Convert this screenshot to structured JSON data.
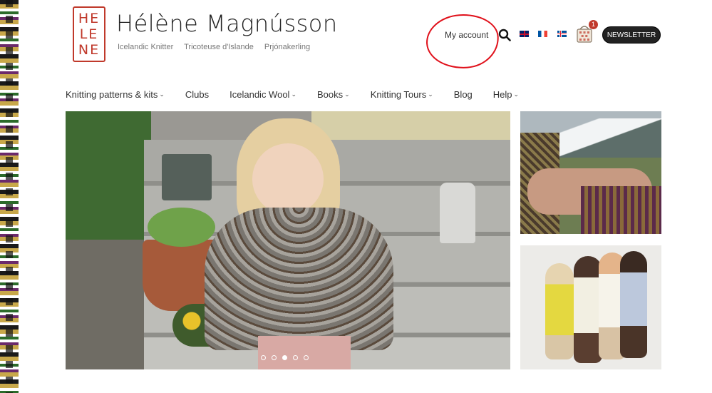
{
  "brand": {
    "logo_letters": [
      "HE",
      "LE",
      "NE"
    ],
    "name": "Hélène Magnússon",
    "taglines": [
      "Icelandic Knitter",
      "Tricoteuse d'Islande",
      "Prjónakerling"
    ]
  },
  "header": {
    "my_account": "My account",
    "cart_count": "1",
    "newsletter": "NEWSLETTER",
    "flags": [
      "uk-flag-icon",
      "france-flag-icon",
      "iceland-flag-icon"
    ]
  },
  "nav": {
    "items": [
      {
        "label": "Knitting patterns & kits",
        "dropdown": true
      },
      {
        "label": "Clubs",
        "dropdown": false
      },
      {
        "label": "Icelandic Wool",
        "dropdown": true
      },
      {
        "label": "Books",
        "dropdown": true
      },
      {
        "label": "Knitting Tours",
        "dropdown": true
      },
      {
        "label": "Blog",
        "dropdown": false
      },
      {
        "label": "Help",
        "dropdown": true
      }
    ]
  },
  "slider": {
    "total_slides": 5,
    "active_slide": 3
  },
  "colors": {
    "brand_red": "#c0392b",
    "annotation_red": "#e0101a",
    "button_dark": "#222222"
  }
}
